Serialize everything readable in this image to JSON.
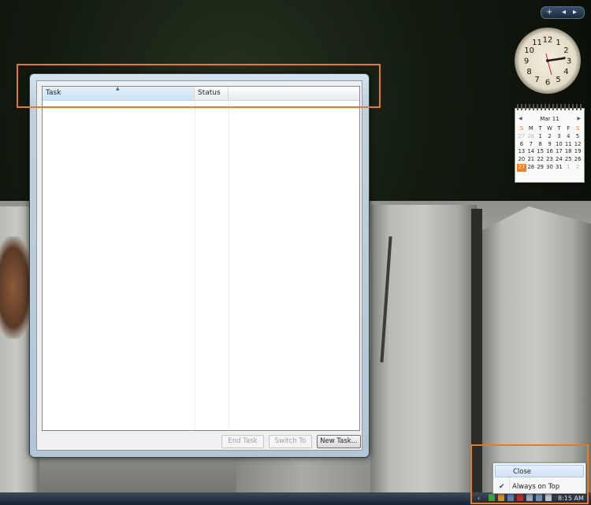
{
  "task_manager": {
    "columns": [
      "Task",
      "Status",
      ""
    ],
    "sort_indicator": "▲",
    "tasks": [],
    "buttons": {
      "end_task": "End Task",
      "switch_to": "Switch To",
      "new_task": "New Task..."
    }
  },
  "gadget_controls": {
    "add": "+",
    "prev": "◂",
    "next": "▸"
  },
  "calendar": {
    "month": "Mar 11",
    "prev": "◀",
    "next": "▶",
    "weekdays": [
      "S",
      "M",
      "T",
      "W",
      "T",
      "F",
      "S"
    ],
    "weeks": [
      [
        "27",
        "28",
        "1",
        "2",
        "3",
        "4",
        "5"
      ],
      [
        "6",
        "7",
        "8",
        "9",
        "10",
        "11",
        "12"
      ],
      [
        "13",
        "14",
        "15",
        "16",
        "17",
        "18",
        "19"
      ],
      [
        "20",
        "21",
        "22",
        "23",
        "24",
        "25",
        "26"
      ],
      [
        "27",
        "28",
        "29",
        "30",
        "31",
        "1",
        "2"
      ]
    ],
    "today": "27"
  },
  "clock_numerals": [
    "12",
    "1",
    "2",
    "3",
    "4",
    "5",
    "6",
    "7",
    "8",
    "9",
    "10",
    "11"
  ],
  "context_menu": {
    "items": [
      {
        "label": "Close",
        "checked": false
      },
      {
        "label": "Always on Top",
        "checked": true
      }
    ]
  },
  "taskbar": {
    "tray_chevron": "‹",
    "time": "8:15 AM"
  },
  "colors": {
    "highlight": "#e87a22",
    "selection": "#c9e4f6",
    "today": "#f08020"
  }
}
